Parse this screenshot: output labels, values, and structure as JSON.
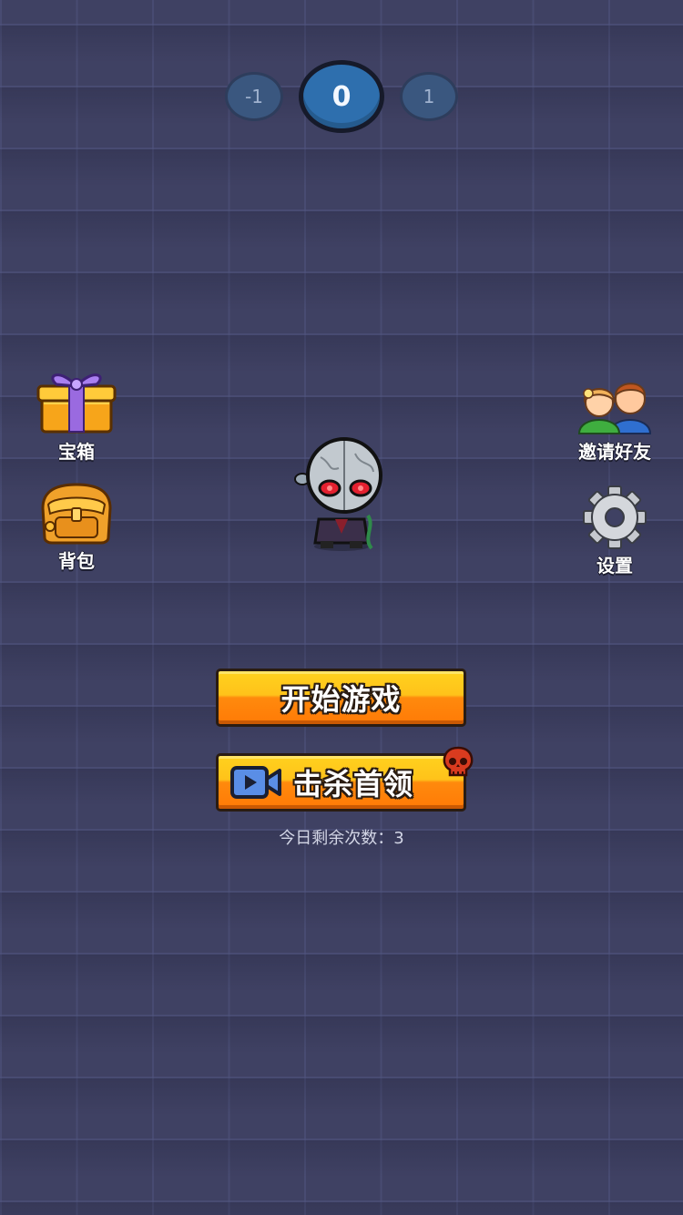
{
  "level_selector": {
    "prev": "-1",
    "current": "0",
    "next": "1"
  },
  "left_menu": [
    {
      "label": "宝箱",
      "icon": "gift-box-icon"
    },
    {
      "label": "背包",
      "icon": "backpack-icon"
    }
  ],
  "right_menu": [
    {
      "label": "邀请好友",
      "icon": "friends-icon"
    },
    {
      "label": "设置",
      "icon": "gear-icon"
    }
  ],
  "buttons": {
    "start": "开始游戏",
    "kill_boss": "击杀首领"
  },
  "remaining_text": "今日剩余次数：3",
  "colors": {
    "background": "#3f4163",
    "button_top": "#ffc21a",
    "button_bottom": "#ff7a06",
    "level_current": "#2e6fae"
  }
}
